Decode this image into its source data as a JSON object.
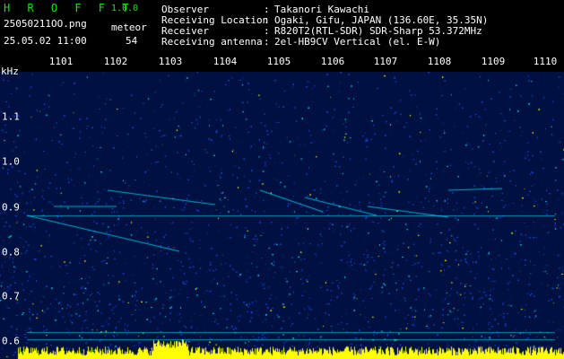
{
  "app": {
    "brand": "H R O F F T",
    "version": "1.0.0",
    "filename": "25050211OO.png",
    "datetime": "25.05.02 11:00",
    "counter_label": "meteor",
    "counter_value": "54"
  },
  "station": {
    "rows": [
      {
        "label": "Observer",
        "sep": ":",
        "value": "Takanori Kawachi"
      },
      {
        "label": "Receiving Location",
        "sep": ":",
        "value": "Ogaki, Gifu, JAPAN (136.60E, 35.35N)"
      },
      {
        "label": "Receiver",
        "sep": ":",
        "value": "R820T2(RTL-SDR) SDR-Sharp 53.372MHz"
      },
      {
        "label": "Receiving antenna",
        "sep": ":",
        "value": "2el-HB9CV Vertical (el. E-W)"
      }
    ]
  },
  "spectrogram": {
    "y_unit": "kHz",
    "x_ticks": [
      "1101",
      "1102",
      "1103",
      "1104",
      "1105",
      "1106",
      "1107",
      "1108",
      "1109",
      "1110"
    ],
    "y_ticks": [
      "1.1",
      "1.0",
      "0.9",
      "0.8",
      "0.7",
      "0.6"
    ],
    "colors": {
      "background": "#001040",
      "noise": "#1a4cff",
      "echo": "#00e0ff",
      "strong": "#ff3030",
      "baseline": "#ffff00",
      "text": "#ffffff",
      "accent": "#19e019"
    }
  }
}
